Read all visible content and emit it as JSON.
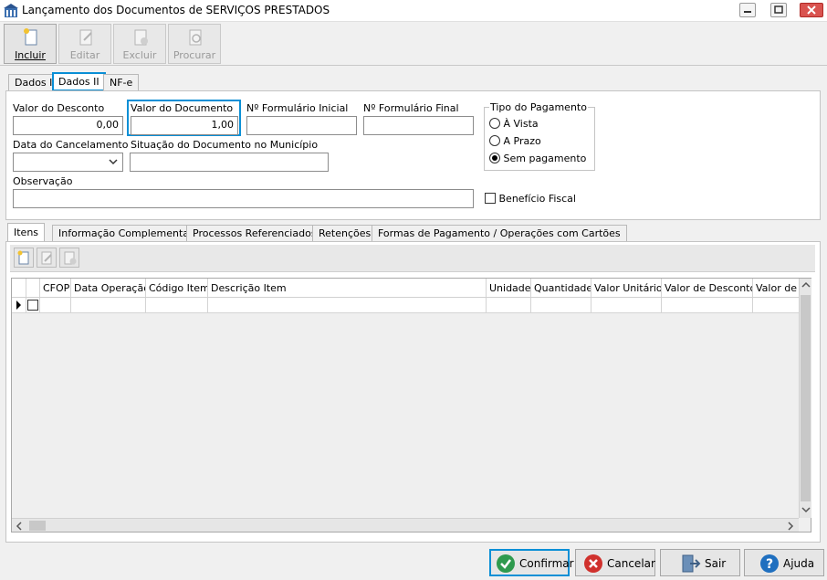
{
  "window": {
    "title": "Lançamento dos Documentos de SERVIÇOS PRESTADOS"
  },
  "toolbar": {
    "buttons": [
      {
        "label": "Incluir",
        "enabled": true
      },
      {
        "label": "Editar",
        "enabled": false
      },
      {
        "label": "Excluir",
        "enabled": false
      },
      {
        "label": "Procurar",
        "enabled": false
      }
    ]
  },
  "top_tabs": [
    "Dados I",
    "Dados II",
    "NF-e"
  ],
  "form": {
    "valor_desconto": {
      "label": "Valor do Desconto",
      "value": "0,00"
    },
    "valor_documento": {
      "label": "Valor do Documento",
      "value": "1,00"
    },
    "formulario_inicial": {
      "label": "Nº Formulário Inicial",
      "value": ""
    },
    "formulario_final": {
      "label": "Nº Formulário Final",
      "value": ""
    },
    "data_cancelamento": {
      "label": "Data do Cancelamento",
      "value": ""
    },
    "situacao": {
      "label": "Situação do Documento no Município",
      "value": ""
    },
    "observacao": {
      "label": "Observação",
      "value": ""
    },
    "tipo_pagamento": {
      "label": "Tipo do Pagamento",
      "options": [
        "À Vista",
        "A Prazo",
        "Sem pagamento"
      ],
      "selected": "Sem pagamento"
    },
    "beneficio_fiscal": {
      "label": "Benefício Fiscal",
      "checked": false
    }
  },
  "bottom_tabs": [
    "Itens",
    "Informação Complementar",
    "Processos Referenciados",
    "Retenções",
    "Formas de Pagamento / Operações com Cartões"
  ],
  "grid": {
    "columns": [
      "CFOP",
      "Data Operação",
      "Código Item",
      "Descrição Item",
      "Unidade",
      "Quantidade",
      "Valor Unitário",
      "Valor de Desconto",
      "Valor de A"
    ],
    "rows": []
  },
  "footer": {
    "confirmar": "Confirmar",
    "cancelar": "Cancelar",
    "sair": "Sair",
    "ajuda": "Ajuda"
  },
  "colors": {
    "highlight": "#0a8fd6",
    "confirm_icon": "#2e9a4e",
    "cancel_icon": "#d0312d",
    "help_icon": "#1f6fbf"
  }
}
